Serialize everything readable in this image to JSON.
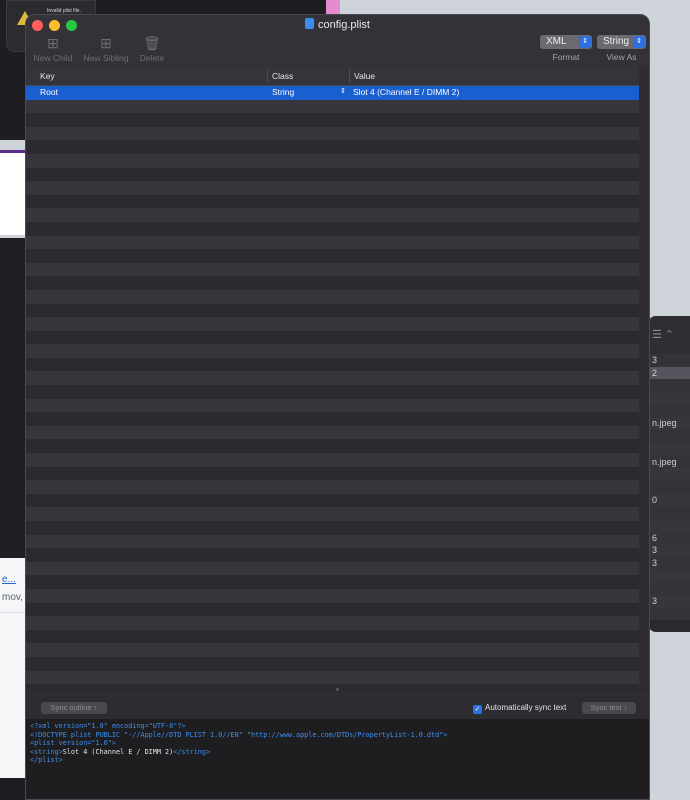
{
  "background": {
    "alert_text": "Invalid plist file.",
    "left_link": "e...",
    "left_text": "mov,",
    "right_rows": [
      "3",
      "2",
      "",
      "",
      "",
      "n.jpeg",
      "",
      "",
      "n.jpeg",
      "",
      "",
      "0",
      "",
      "",
      "6",
      "3",
      "3",
      "",
      "",
      "3",
      ""
    ]
  },
  "window": {
    "title": "config.plist",
    "toolbar": {
      "new_child": "New Child",
      "new_sibling": "New Sibling",
      "delete": "Delete",
      "format_value": "XML",
      "format_label": "Format",
      "view_value": "String",
      "view_label": "View As"
    },
    "table": {
      "headers": {
        "key": "Key",
        "class": "Class",
        "value": "Value"
      },
      "rows": [
        {
          "key": "Root",
          "class": "String",
          "value": "Slot 4 (Channel E / DIMM 2)",
          "selected": true
        }
      ]
    },
    "sync": {
      "sync_outline": "Sync outline ↑",
      "auto_sync": "Automatically sync text",
      "auto_sync_checked": true,
      "sync_text": "Sync text ↓"
    },
    "xml_lines": [
      "<?xml version=\"1.0\" encoding=\"UTF-8\"?>",
      "<!DOCTYPE plist PUBLIC \"-//Apple//DTD PLIST 1.0//EN\" \"http://www.apple.com/DTDs/PropertyList-1.0.dtd\">",
      "<plist version=\"1.0\">",
      "<string>",
      "Slot 4 (Channel E / DIMM 2)",
      "</string>",
      "</plist>"
    ]
  },
  "colors": {
    "selection": "#1a5fd0",
    "xml_tag": "#3d8ff0",
    "accent": "#2c6fe0"
  }
}
